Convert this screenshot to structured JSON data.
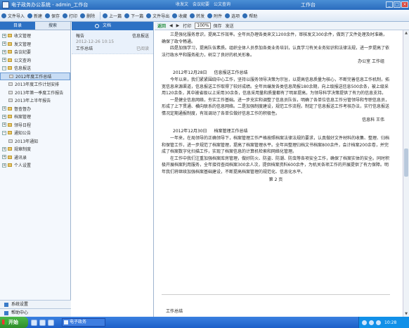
{
  "window": {
    "title": "电子政务办公系统 - admin_工作台",
    "tabs": [
      "收发文",
      "会议纪要",
      "公文查询"
    ],
    "user": "工作台",
    "min": "_",
    "max": "□",
    "close": "×"
  },
  "toolbar": {
    "items": [
      "文件导入",
      "新建",
      "保存",
      "打印",
      "删除",
      "上一篇",
      "下一篇",
      "文件导出",
      "收藏",
      "转发",
      "附件",
      "选项",
      "帮助"
    ]
  },
  "sidebar": {
    "tabs": [
      "目录",
      "搜索"
    ],
    "tree": [
      {
        "label": "收文管理",
        "level": 1,
        "expanded": false
      },
      {
        "label": "发文管理",
        "level": 1,
        "expanded": false
      },
      {
        "label": "会议纪要",
        "level": 1,
        "expanded": false
      },
      {
        "label": "公文查询",
        "level": 1,
        "expanded": false
      },
      {
        "label": "信息报送",
        "level": 1,
        "expanded": true
      },
      {
        "label": "2012年度工作总结",
        "level": 2,
        "selected": true
      },
      {
        "label": "2013年度工作计划安排",
        "level": 2
      },
      {
        "label": "2013年第一季度工作报告",
        "level": 2
      },
      {
        "label": "2013年上半年报告",
        "level": 2
      },
      {
        "label": "督查督办",
        "level": 1,
        "expanded": false
      },
      {
        "label": "档案管理",
        "level": 1,
        "expanded": false
      },
      {
        "label": "领导日程",
        "level": 1,
        "expanded": false
      },
      {
        "label": "通知公告",
        "level": 1,
        "expanded": true
      },
      {
        "label": "2013年通知",
        "level": 2
      },
      {
        "label": "规章制度",
        "level": 1,
        "expanded": false
      },
      {
        "label": "通讯录",
        "level": 1,
        "expanded": false
      },
      {
        "label": "个人设置",
        "level": 1,
        "expanded": false
      }
    ],
    "footer": [
      "系统设置",
      "帮助中心"
    ]
  },
  "list": {
    "header": "文档",
    "items": [
      {
        "title": "報告",
        "tag": "信息报送",
        "date": "2012-12-26 10:15",
        "author": "工作总结",
        "status": "已阅读"
      }
    ]
  },
  "doc": {
    "toolbar": [
      "返回",
      "◀",
      "▶",
      "打印",
      "保存",
      "发送"
    ],
    "zoom": "100%",
    "paragraphs_1": [
      "三是强化服务意识，提高工作效率。全年共办理各类来文1200余件，审核发文300余件，做到了文件处理及时准确，确保了政令畅通。",
      "四是加强学习，提高队伍素质。组织全体人员参加各类业务培训，认真学习有关业务知识和法律法规，进一步提高了依法行政水平和服务能力，树立了良好的机关形象。"
    ],
    "sig_1": "办公室 工作组",
    "head_2": {
      "date": "2012年12月28日",
      "title": "信息报送工作总结"
    },
    "paragraphs_2": [
      "今年以来，我们紧紧围绕中心工作，坚持以服务领导决策为宗旨，以提高信息质量为核心，不断完善信息工作机制，拓宽信息来源渠道，信息报送工作取得了较好成绩。全年共编发各类信息简报180余期，向上级报送信息500余条，被上级采用120余条，其中被省级以上采用30余条，信息采用量和质量都有了明显提高，为领导科学决策提供了有力的信息支持。",
      "一是健全信息网络，夯实工作基础。进一步充实和调整了信息员队伍，明确了各单位信息工作分管领导和专职信息员，形成了上下贯通、横向联系的信息网络。二是加强制度建设，规范工作流程。制定了信息报送工作考核办法，实行信息报送情况定期通报制度，有效调动了各单位做好信息工作的积极性。"
    ],
    "sig_2": "信息科 王伟",
    "head_3": {
      "date": "2012年12月30日",
      "title": "档案管理工作总结"
    },
    "paragraphs_3": [
      "一年来，在局领导的正确领导下，档案管理工作严格按照档案法律法规的要求，认真做好文件材料的收集、整理、归档和保管工作，进一步规范了档案管理，提高了档案管理水平。全年共整理归档文书档案800余件，会计档案200余卷，并完成了档案数字化扫描工作，实现了档案信息的计算机检索和网络化管理。",
      "在工作中我们注重加强档案库房管理，做好防火、防盗、防潮、防虫等各项安全工作，确保了档案实体的安全。同时积极开展档案利用服务，全年接待查阅档案300余人次，提供档案资料600余件，为机关各项工作的开展提供了有力保障。明年我们将继续加强档案基础建设，不断提高档案管理的规范化、信息化水平。"
    ],
    "page_label": "第 2 页",
    "next_page_text": "工作总结"
  },
  "taskbar": {
    "start": "开始",
    "task": "电子政务",
    "time": "10:28"
  }
}
